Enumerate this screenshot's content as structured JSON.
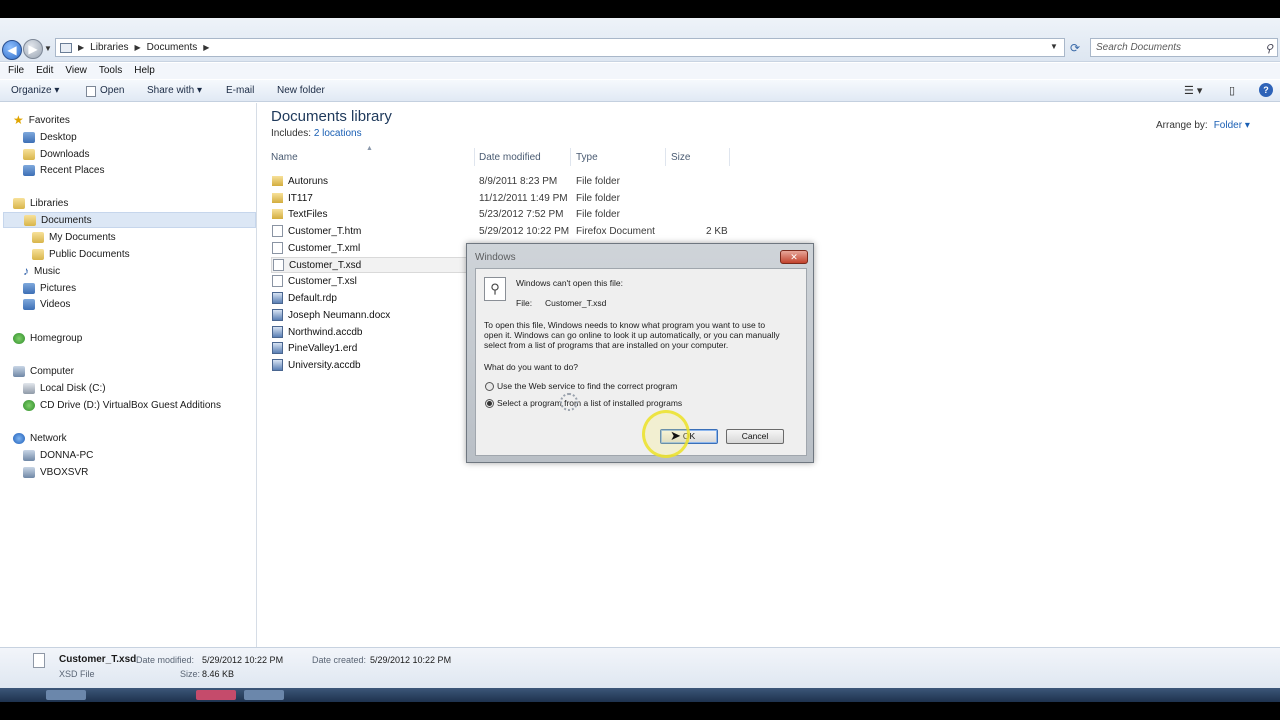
{
  "breadcrumb": [
    "Libraries",
    "Documents"
  ],
  "search": {
    "placeholder": "Search Documents"
  },
  "menu": [
    "File",
    "Edit",
    "View",
    "Tools",
    "Help"
  ],
  "toolbar": {
    "organize": "Organize ▾",
    "open": "Open",
    "share_with": "Share with ▾",
    "email": "E-mail",
    "new_folder": "New folder"
  },
  "sidebar": {
    "favorites": "Favorites",
    "desktop": "Desktop",
    "downloads": "Downloads",
    "recent": "Recent Places",
    "libraries": "Libraries",
    "documents": "Documents",
    "my_documents": "My Documents",
    "public_documents": "Public Documents",
    "music": "Music",
    "pictures": "Pictures",
    "videos": "Videos",
    "homegroup": "Homegroup",
    "computer": "Computer",
    "local_disk": "Local Disk (C:)",
    "cd_drive": "CD Drive (D:) VirtualBox Guest Additions",
    "network": "Network",
    "donna_pc": "DONNA-PC",
    "vboxsvr": "VBOXSVR"
  },
  "library": {
    "title": "Documents library",
    "includes_label": "Includes:",
    "includes_link": "2 locations",
    "arrange_label": "Arrange by:",
    "arrange_value": "Folder ▾"
  },
  "columns": {
    "name": "Name",
    "date": "Date modified",
    "type": "Type",
    "size": "Size"
  },
  "files": [
    {
      "name": "Autoruns",
      "date": "8/9/2011 8:23 PM",
      "type": "File folder",
      "size": ""
    },
    {
      "name": "IT117",
      "date": "11/12/2011 1:49 PM",
      "type": "File folder",
      "size": ""
    },
    {
      "name": "TextFiles",
      "date": "5/23/2012 7:52 PM",
      "type": "File folder",
      "size": ""
    },
    {
      "name": "Customer_T.htm",
      "date": "5/29/2012 10:22 PM",
      "type": "Firefox Document",
      "size": "2 KB"
    },
    {
      "name": "Customer_T.xml",
      "date": "",
      "type": "",
      "size": ""
    },
    {
      "name": "Customer_T.xsd",
      "date": "",
      "type": "",
      "size": ""
    },
    {
      "name": "Customer_T.xsl",
      "date": "",
      "type": "",
      "size": ""
    },
    {
      "name": "Default.rdp",
      "date": "",
      "type": "",
      "size": ""
    },
    {
      "name": "Joseph Neumann.docx",
      "date": "",
      "type": "",
      "size": ""
    },
    {
      "name": "Northwind.accdb",
      "date": "",
      "type": "",
      "size": ""
    },
    {
      "name": "PineValley1.erd",
      "date": "",
      "type": "",
      "size": ""
    },
    {
      "name": "University.accdb",
      "date": "",
      "type": "",
      "size": ""
    }
  ],
  "details": {
    "name": "Customer_T.xsd",
    "type": "XSD File",
    "date_modified_label": "Date modified:",
    "date_modified": "5/29/2012 10:22 PM",
    "date_created_label": "Date created:",
    "date_created": "5/29/2012 10:22 PM",
    "size_label": "Size:",
    "size": "8.46 KB"
  },
  "dialog": {
    "title": "Windows",
    "heading": "Windows can't open this file:",
    "file_label": "File:",
    "file_name": "Customer_T.xsd",
    "explain_1": "To open this file, Windows needs to know what program you want to use to",
    "explain_2": "open it. Windows can go online to look it up automatically, or you can manually",
    "explain_3": "select from a list of programs that are installed on your computer.",
    "question": "What do you want to do?",
    "option_web": "Use the Web service to find the correct program",
    "option_list": "Select a program from a list of installed programs",
    "ok": "OK",
    "cancel": "Cancel"
  }
}
